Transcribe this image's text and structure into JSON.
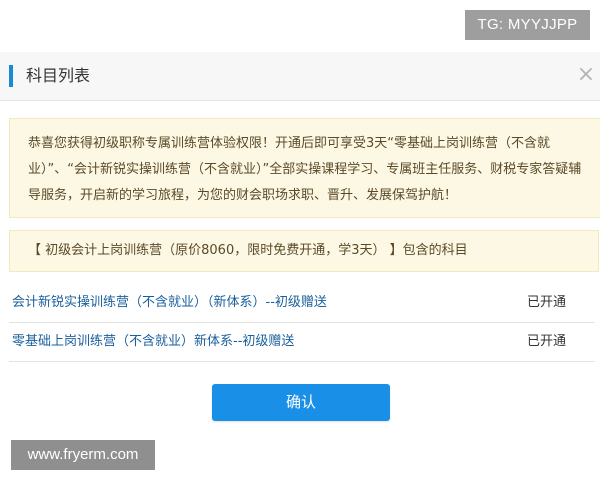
{
  "watermark": {
    "top_badge": "TG: MYYJJPP",
    "bottom_badge": "www.fryerm.com"
  },
  "dialog": {
    "title": "科目列表",
    "close_icon": "×",
    "notice": "恭喜您获得初级职称专属训练营体验权限！开通后即可享受3天“零基础上岗训练营（不含就业）”、“会计新锐实操训练营（不含就业）”全部实操课程学习、专属班主任服务、财税专家答疑辅导服务，开启新的学习旅程，为您的财会职场求职、晋升、发展保驾护航！",
    "camp_header": "【 初级会计上岗训练营（原价8060，限时免费开通，学3天） 】包含的科目",
    "courses": [
      {
        "name": "会计新锐实操训练营（不含就业）（新体系）--初级赠送",
        "status": "已开通"
      },
      {
        "name": "零基础上岗训练营（不含就业）新体系--初级赠送",
        "status": "已开通"
      }
    ],
    "confirm_label": "确认"
  },
  "colors": {
    "accent": "#1a8fe8",
    "title_bar": "#1a8ad6",
    "notice_bg": "#fdf8e3",
    "link": "#1a5f9c"
  }
}
